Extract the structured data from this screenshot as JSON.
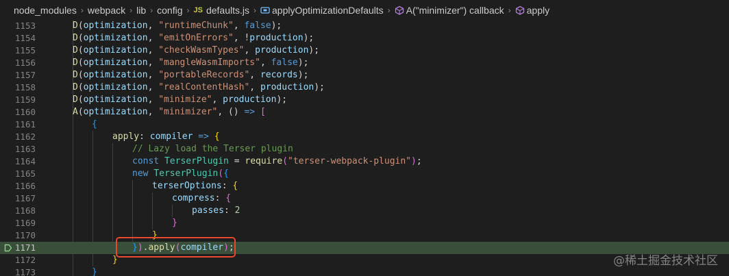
{
  "breadcrumb": {
    "items": [
      "node_modules",
      "webpack",
      "lib",
      "config"
    ],
    "file_badge": "JS",
    "file_name": "defaults.js",
    "symbols": [
      "applyOptimizationDefaults",
      "A(\"minimizer\") callback",
      "apply"
    ]
  },
  "editor": {
    "lines": [
      {
        "num": "1153",
        "tokens": [
          [
            "fn",
            "D"
          ],
          [
            "op",
            "("
          ],
          [
            "var",
            "optimization"
          ],
          [
            "op",
            ", "
          ],
          [
            "str",
            "\"runtimeChunk\""
          ],
          [
            "op",
            ", "
          ],
          [
            "kw",
            "false"
          ],
          [
            "op",
            ");"
          ]
        ],
        "indent": 106
      },
      {
        "num": "1154",
        "tokens": [
          [
            "fn",
            "D"
          ],
          [
            "op",
            "("
          ],
          [
            "var",
            "optimization"
          ],
          [
            "op",
            ", "
          ],
          [
            "str",
            "\"emitOnErrors\""
          ],
          [
            "op",
            ", !"
          ],
          [
            "var",
            "production"
          ],
          [
            "op",
            ");"
          ]
        ],
        "indent": 106
      },
      {
        "num": "1155",
        "tokens": [
          [
            "fn",
            "D"
          ],
          [
            "op",
            "("
          ],
          [
            "var",
            "optimization"
          ],
          [
            "op",
            ", "
          ],
          [
            "str",
            "\"checkWasmTypes\""
          ],
          [
            "op",
            ", "
          ],
          [
            "var",
            "production"
          ],
          [
            "op",
            ");"
          ]
        ],
        "indent": 106
      },
      {
        "num": "1156",
        "tokens": [
          [
            "fn",
            "D"
          ],
          [
            "op",
            "("
          ],
          [
            "var",
            "optimization"
          ],
          [
            "op",
            ", "
          ],
          [
            "str",
            "\"mangleWasmImports\""
          ],
          [
            "op",
            ", "
          ],
          [
            "kw",
            "false"
          ],
          [
            "op",
            ");"
          ]
        ],
        "indent": 106
      },
      {
        "num": "1157",
        "tokens": [
          [
            "fn",
            "D"
          ],
          [
            "op",
            "("
          ],
          [
            "var",
            "optimization"
          ],
          [
            "op",
            ", "
          ],
          [
            "str",
            "\"portableRecords\""
          ],
          [
            "op",
            ", "
          ],
          [
            "var",
            "records"
          ],
          [
            "op",
            ");"
          ]
        ],
        "indent": 106
      },
      {
        "num": "1158",
        "tokens": [
          [
            "fn",
            "D"
          ],
          [
            "op",
            "("
          ],
          [
            "var",
            "optimization"
          ],
          [
            "op",
            ", "
          ],
          [
            "str",
            "\"realContentHash\""
          ],
          [
            "op",
            ", "
          ],
          [
            "var",
            "production"
          ],
          [
            "op",
            ");"
          ]
        ],
        "indent": 106
      },
      {
        "num": "1159",
        "tokens": [
          [
            "fn",
            "D"
          ],
          [
            "op",
            "("
          ],
          [
            "var",
            "optimization"
          ],
          [
            "op",
            ", "
          ],
          [
            "str",
            "\"minimize\""
          ],
          [
            "op",
            ", "
          ],
          [
            "var",
            "production"
          ],
          [
            "op",
            ");"
          ]
        ],
        "indent": 106
      },
      {
        "num": "1160",
        "tokens": [
          [
            "fn",
            "A"
          ],
          [
            "op",
            "("
          ],
          [
            "var",
            "optimization"
          ],
          [
            "op",
            ", "
          ],
          [
            "str",
            "\"minimizer\""
          ],
          [
            "op",
            ", () "
          ],
          [
            "kw",
            "=>"
          ],
          [
            "op",
            " "
          ],
          [
            "b2",
            "["
          ]
        ],
        "indent": 106
      },
      {
        "num": "1161",
        "tokens": [
          [
            "b3",
            "{"
          ]
        ],
        "indent": 134
      },
      {
        "num": "1162",
        "tokens": [
          [
            "fn",
            "apply"
          ],
          [
            "op",
            ": "
          ],
          [
            "var",
            "compiler"
          ],
          [
            "op",
            " "
          ],
          [
            "kw",
            "=>"
          ],
          [
            "op",
            " "
          ],
          [
            "b1",
            "{"
          ]
        ],
        "indent": 164
      },
      {
        "num": "1163",
        "tokens": [
          [
            "cm",
            "// Lazy load the Terser plugin"
          ]
        ],
        "indent": 193
      },
      {
        "num": "1164",
        "tokens": [
          [
            "kw",
            "const"
          ],
          [
            "op",
            " "
          ],
          [
            "cls",
            "TerserPlugin"
          ],
          [
            "op",
            " = "
          ],
          [
            "fn",
            "require"
          ],
          [
            "b2",
            "("
          ],
          [
            "str",
            "\"terser-webpack-plugin\""
          ],
          [
            "b2",
            ")"
          ],
          [
            "op",
            ";"
          ]
        ],
        "indent": 193
      },
      {
        "num": "1165",
        "tokens": [
          [
            "kw",
            "new"
          ],
          [
            "op",
            " "
          ],
          [
            "cls",
            "TerserPlugin"
          ],
          [
            "b2",
            "("
          ],
          [
            "b3",
            "{"
          ]
        ],
        "indent": 193
      },
      {
        "num": "1166",
        "tokens": [
          [
            "prop",
            "terserOptions"
          ],
          [
            "op",
            ": "
          ],
          [
            "b1",
            "{"
          ]
        ],
        "indent": 222
      },
      {
        "num": "1167",
        "tokens": [
          [
            "prop",
            "compress"
          ],
          [
            "op",
            ": "
          ],
          [
            "b2",
            "{"
          ]
        ],
        "indent": 251
      },
      {
        "num": "1168",
        "tokens": [
          [
            "prop",
            "passes"
          ],
          [
            "op",
            ": "
          ],
          [
            "num",
            "2"
          ]
        ],
        "indent": 280
      },
      {
        "num": "1169",
        "tokens": [
          [
            "b2",
            "}"
          ]
        ],
        "indent": 251
      },
      {
        "num": "1170",
        "tokens": [
          [
            "b1",
            "}"
          ]
        ],
        "indent": 222
      },
      {
        "num": "1171",
        "tokens": [
          [
            "b3",
            "}"
          ],
          [
            "b2",
            ")"
          ],
          [
            "op",
            "."
          ],
          [
            "fn",
            "apply"
          ],
          [
            "b2",
            "("
          ],
          [
            "var",
            "compiler"
          ],
          [
            "b2",
            ")"
          ],
          [
            "op",
            ";"
          ]
        ],
        "indent": 193,
        "active": true,
        "breakpoint": true
      },
      {
        "num": "1172",
        "tokens": [
          [
            "b1",
            "}"
          ]
        ],
        "indent": 164
      },
      {
        "num": "1173",
        "tokens": [
          [
            "b3",
            "}"
          ]
        ],
        "indent": 134
      }
    ]
  },
  "watermark": "@稀土掘金技术社区",
  "colors": {
    "background": "#1e1e1e",
    "active_line": "#3a4f39",
    "highlight_border": "#e8492c",
    "breakpoint": "#89d185"
  }
}
